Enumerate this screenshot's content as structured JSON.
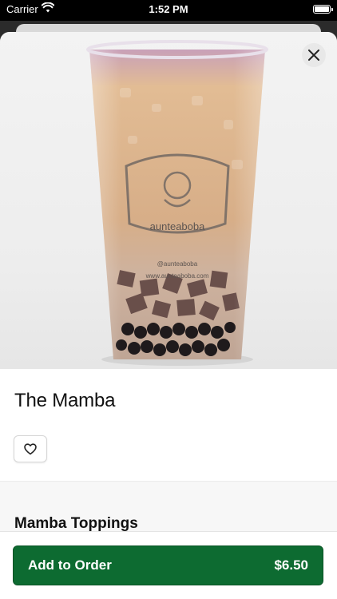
{
  "status_bar": {
    "carrier": "Carrier",
    "time": "1:52 PM"
  },
  "item": {
    "name": "The Mamba",
    "image_logo_lines": [
      "auntea",
      "boba"
    ],
    "image_handle": "@aunteaboba",
    "image_url_text": "www.aunteaboba.com"
  },
  "sections": {
    "toppings_heading": "Mamba Toppings"
  },
  "order": {
    "add_label": "Add to Order",
    "price": "$6.50"
  },
  "colors": {
    "accent": "#0d6b31",
    "drink": "#d9b38e",
    "boba": "#2b2324"
  },
  "icons": {
    "close": "close-icon",
    "favorite": "heart-icon",
    "wifi": "wifi-icon",
    "battery": "battery-icon"
  }
}
